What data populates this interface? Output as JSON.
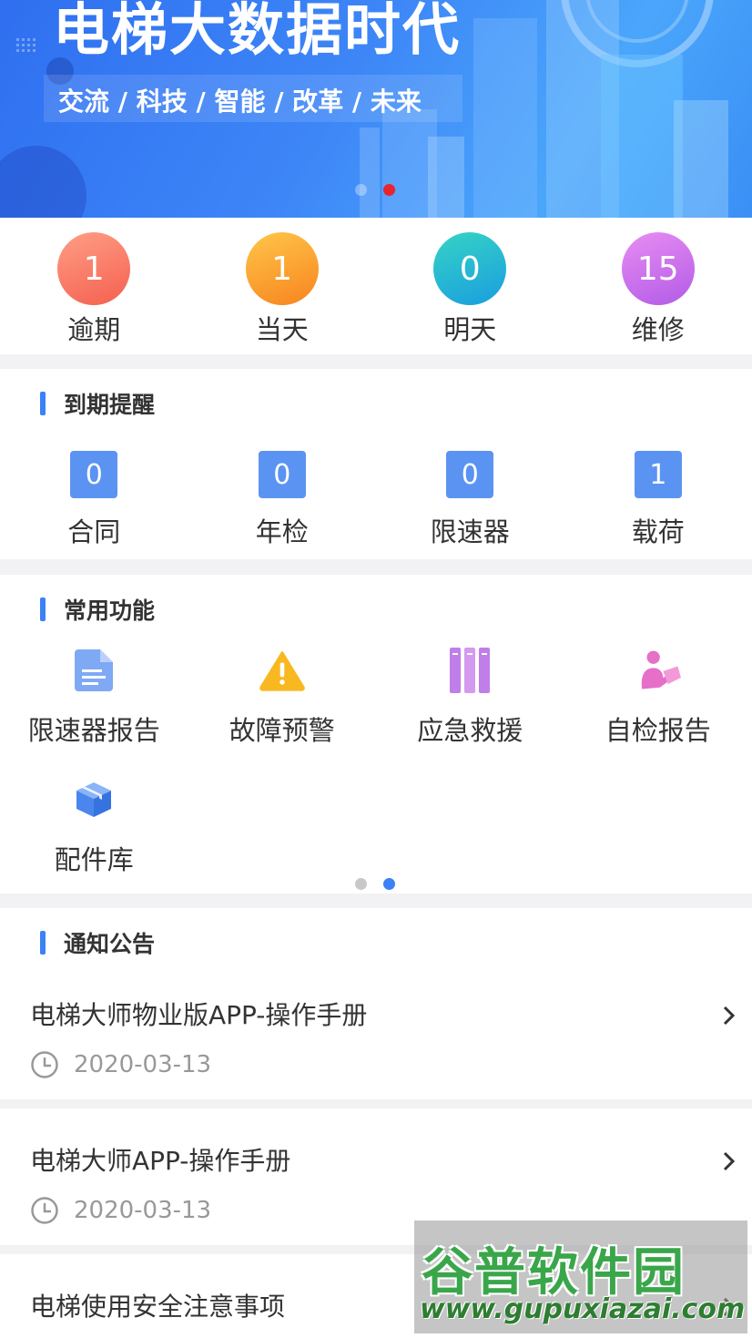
{
  "banner": {
    "title": "电梯大数据时代",
    "subtitle": "交流 / 科技 / 智能 / 改革 / 未来",
    "active_slide": 2,
    "slide_count": 2
  },
  "stats": [
    {
      "value": "1",
      "label": "逾期",
      "color_from": "#ff9e86",
      "color_to": "#f4604f"
    },
    {
      "value": "1",
      "label": "当天",
      "color_from": "#ffc64a",
      "color_to": "#f7841f"
    },
    {
      "value": "0",
      "label": "明天",
      "color_from": "#35d4c4",
      "color_to": "#1a9de0"
    },
    {
      "value": "15",
      "label": "维修",
      "color_from": "#e88df3",
      "color_to": "#b25be6"
    }
  ],
  "reminders": {
    "title": "到期提醒",
    "items": [
      {
        "value": "0",
        "label": "合同"
      },
      {
        "value": "0",
        "label": "年检"
      },
      {
        "value": "0",
        "label": "限速器"
      },
      {
        "value": "1",
        "label": "载荷"
      }
    ]
  },
  "functions": {
    "title": "常用功能",
    "items": [
      {
        "label": "限速器报告",
        "icon": "document-icon"
      },
      {
        "label": "故障预警",
        "icon": "warning-icon"
      },
      {
        "label": "应急救援",
        "icon": "books-icon"
      },
      {
        "label": "自检报告",
        "icon": "person-reading-icon"
      },
      {
        "label": "配件库",
        "icon": "box-icon"
      }
    ],
    "active_page": 2,
    "page_count": 2
  },
  "notices": {
    "title": "通知公告",
    "items": [
      {
        "title": "电梯大师物业版APP-操作手册",
        "date": "2020-03-13"
      },
      {
        "title": "电梯大师APP-操作手册",
        "date": "2020-03-13"
      },
      {
        "title": "电梯使用安全注意事项",
        "date": ""
      }
    ]
  },
  "watermark": {
    "logo": "谷普软件园",
    "url": "www.gupuxiazai.com"
  },
  "colors": {
    "accent": "#3b82f6",
    "reminder_box": "#5b93f2",
    "active_dot_banner": "#e8242f",
    "active_dot_func": "#3b82f6",
    "inactive_dot": "#c8c8c8"
  }
}
